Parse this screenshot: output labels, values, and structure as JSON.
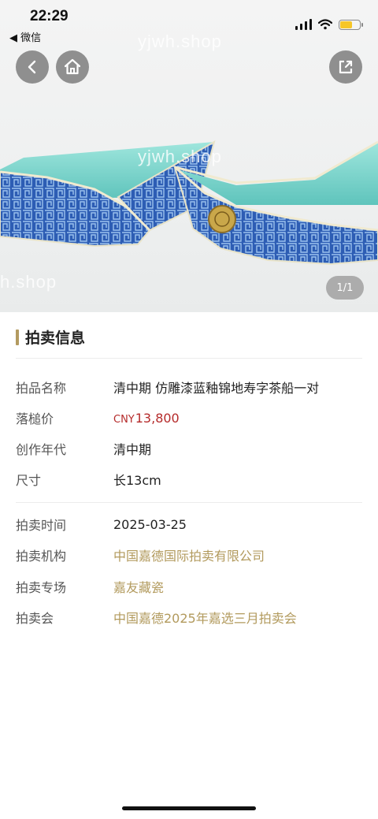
{
  "status_bar": {
    "time": "22:29",
    "back_app_label": "◀ 微信"
  },
  "hero": {
    "image_alt": "清中期 仿雕漆蓝釉锦地寿字茶船一对",
    "counter": "1/1",
    "watermark": "yjwh.shop",
    "watermark_partial": "h.shop"
  },
  "nav": {
    "back_icon": "chevron-left-icon",
    "home_icon": "home-icon",
    "share_icon": "share-icon"
  },
  "section": {
    "title": "拍卖信息"
  },
  "info": {
    "item_name": {
      "label": "拍品名称",
      "value": "清中期 仿雕漆蓝釉锦地寿字茶船一对"
    },
    "hammer_price": {
      "label": "落槌价",
      "currency": "CNY",
      "value": "13,800"
    },
    "era": {
      "label": "创作年代",
      "value": "清中期"
    },
    "size": {
      "label": "尺寸",
      "value": "长13cm"
    },
    "auction_time": {
      "label": "拍卖时间",
      "value": "2025-03-25"
    },
    "auction_house": {
      "label": "拍卖机构",
      "value": "中国嘉德国际拍卖有限公司"
    },
    "auction_session": {
      "label": "拍卖专场",
      "value": "嘉友藏瓷"
    },
    "auction_event": {
      "label": "拍卖会",
      "value": "中国嘉德2025年嘉选三月拍卖会"
    }
  },
  "colors": {
    "accent_gold": "#b29a5d",
    "price_red": "#b52b2b",
    "porcelain_blue": "#2f5fb8",
    "glaze_turquoise": "#7fd7cf"
  }
}
